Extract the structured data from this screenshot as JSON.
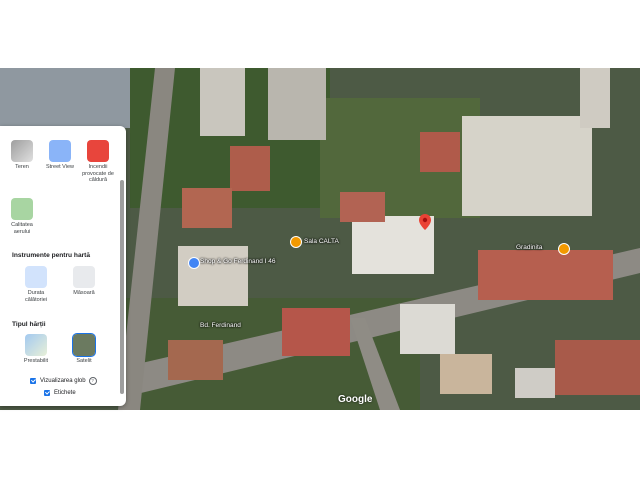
{
  "panel": {
    "layers_row1": [
      {
        "label": "Teren"
      },
      {
        "label": "Street View"
      },
      {
        "label": "Incendii provocate de căldură"
      }
    ],
    "layers_row2": [
      {
        "label": "Calitatea aerului"
      }
    ],
    "tools_title": "Instrumente pentru hartă",
    "tools": [
      {
        "label": "Durata călătoriei"
      },
      {
        "label": "Măsoară"
      }
    ],
    "map_type_title": "Tipul hărții",
    "map_types": [
      {
        "label": "Prestabilit"
      },
      {
        "label": "Satelit"
      }
    ],
    "options": [
      {
        "label": "Vizualizarea glob",
        "checked": true
      },
      {
        "label": "Etichete",
        "checked": true
      }
    ]
  },
  "map": {
    "labels": [
      {
        "text": "Shop & Go Ferdinand I 46"
      },
      {
        "text": "Bd. Ferdinand"
      },
      {
        "text": "Sala CALTA"
      },
      {
        "text": "Gradinita"
      }
    ],
    "logo": "Google",
    "colors": {
      "accent": "#1a73e8",
      "pin": "#ea4335",
      "poi_orange": "#f29900",
      "poi_blue": "#4285f4"
    }
  }
}
